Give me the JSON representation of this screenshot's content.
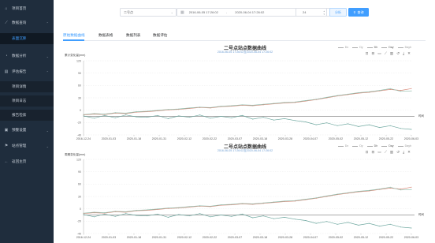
{
  "sidebar": {
    "items": [
      {
        "label": "项目首页",
        "icon": "home-icon",
        "arrow": ""
      },
      {
        "label": "数据查询",
        "icon": "chart-line-icon",
        "arrow": "⌃"
      },
      {
        "label": "表面沉降",
        "icon": "",
        "arrow": ""
      },
      {
        "label": "数据分析",
        "icon": "pie-chart-icon",
        "arrow": "⌄"
      },
      {
        "label": "评估报告",
        "icon": "document-icon",
        "arrow": "⌃"
      },
      {
        "label": "项目详情",
        "icon": "",
        "arrow": ""
      },
      {
        "label": "项目日志",
        "icon": "",
        "arrow": ""
      },
      {
        "label": "报告检索",
        "icon": "",
        "arrow": ""
      },
      {
        "label": "预警设置",
        "icon": "alarm-icon",
        "arrow": "⌄"
      },
      {
        "label": "站点管理",
        "icon": "station-icon",
        "arrow": "⌄"
      },
      {
        "label": "返回主页",
        "icon": "back-icon",
        "arrow": ""
      }
    ]
  },
  "toolbar": {
    "station_select": "二号点",
    "date_start": "2016-06-05 17:26:02",
    "date_end": "2020-06-04 17:26:02",
    "interval_value": "24",
    "reset_label": "分析",
    "query_label": "查询"
  },
  "tabs": [
    {
      "label": "原始数据曲线",
      "active": true
    },
    {
      "label": "数据表格",
      "active": false
    },
    {
      "label": "数据列表",
      "active": false
    },
    {
      "label": "数据评估",
      "active": false
    }
  ],
  "legend": [
    {
      "label": "Dx",
      "active": false
    },
    {
      "label": "Dy",
      "active": false
    },
    {
      "label": "Dh",
      "active": true
    },
    {
      "label": "Day",
      "active": true
    },
    {
      "label": "Dayh",
      "active": false
    }
  ],
  "toolbox_icons": [
    "zoom-in-icon",
    "zoom-reset-icon",
    "data-view-icon",
    "line-chart-icon",
    "bar-chart-icon",
    "restore-icon",
    "download-icon",
    "close-icon"
  ],
  "colors": {
    "series_a": "#6fa8a0",
    "series_b": "#d98a7a",
    "series_c": "#8fb9a8",
    "accent": "#409eff",
    "sidebar": "#1f2d3d"
  },
  "chart_data": [
    {
      "type": "line",
      "title": "二号点站点数据曲线",
      "subtitle": "2016-06-05 17:26:02至2020-06-04 17:26:02",
      "ylabel": "累计变化量(mm)",
      "unit_label": "时间",
      "ylim": [
        -40,
        120
      ],
      "y_ticks": [
        "120",
        "90",
        "60",
        "30",
        "0",
        "-20",
        "-40"
      ],
      "x_ticks": [
        "2016-12-24",
        "2020-01-03",
        "2020-01-18",
        "2020-01-31",
        "2020-02-12",
        "2020-02-22",
        "2020-03-07",
        "2020-03-18",
        "2020-03-28",
        "2020-04-07",
        "2020-05-02",
        "2020-05-12",
        "2020-05-22",
        "2020-06-03"
      ],
      "series": [
        {
          "values": [
            3,
            5,
            4,
            7,
            6,
            9,
            10,
            12,
            14,
            15,
            17,
            19,
            18,
            21,
            22,
            24,
            23,
            25,
            27,
            29,
            30,
            33,
            36,
            40,
            44,
            47,
            50,
            52,
            55,
            58,
            56,
            60
          ]
        },
        {
          "values": [
            4,
            6,
            5,
            8,
            7,
            10,
            11,
            13,
            15,
            16,
            18,
            20,
            19,
            22,
            23,
            25,
            24,
            26,
            28,
            30,
            31,
            34,
            37,
            41,
            45,
            48,
            51,
            53,
            56,
            60,
            54,
            55
          ]
        },
        {
          "values": [
            1,
            -4,
            2,
            -3,
            3,
            -1,
            -2,
            2,
            -5,
            1,
            -2,
            3,
            -4,
            0,
            -3,
            2,
            -6,
            -2,
            -8,
            -5,
            -9,
            -12,
            -18,
            -14,
            -20,
            -16,
            -22,
            -18,
            -24,
            -20,
            -26,
            -28
          ]
        }
      ]
    },
    {
      "type": "line",
      "title": "二号点站点数据曲线",
      "subtitle": "2016-06-05 17:26:02至2020-06-04 17:26:02",
      "ylabel": "周期变化量(mm)",
      "unit_label": "时间",
      "ylim": [
        -40,
        120
      ],
      "y_ticks": [
        "120",
        "90",
        "60",
        "30",
        "0",
        "-20",
        "-40"
      ],
      "x_ticks": [
        "2016-12-24",
        "2020-01-03",
        "2020-01-18",
        "2020-01-31",
        "2020-02-12",
        "2020-02-22",
        "2020-03-07",
        "2020-03-18",
        "2020-03-28",
        "2020-04-07",
        "2020-05-02",
        "2020-05-12",
        "2020-05-22",
        "2020-06-03"
      ],
      "series": [
        {
          "values": [
            3,
            5,
            4,
            7,
            6,
            9,
            10,
            12,
            14,
            15,
            17,
            19,
            18,
            21,
            22,
            24,
            23,
            25,
            27,
            29,
            30,
            33,
            36,
            40,
            44,
            47,
            50,
            52,
            55,
            58,
            56,
            60
          ]
        },
        {
          "values": [
            4,
            6,
            5,
            8,
            7,
            10,
            11,
            13,
            15,
            16,
            18,
            20,
            19,
            22,
            23,
            25,
            24,
            26,
            28,
            30,
            31,
            34,
            37,
            41,
            45,
            48,
            51,
            53,
            56,
            60,
            54,
            55
          ]
        },
        {
          "values": [
            1,
            -4,
            2,
            -3,
            3,
            -1,
            -2,
            2,
            -5,
            1,
            -2,
            3,
            -4,
            0,
            -3,
            2,
            -6,
            -2,
            -8,
            -5,
            -9,
            -12,
            -18,
            -14,
            -20,
            -16,
            -22,
            -18,
            -24,
            -20,
            -26,
            -28
          ]
        }
      ]
    }
  ]
}
